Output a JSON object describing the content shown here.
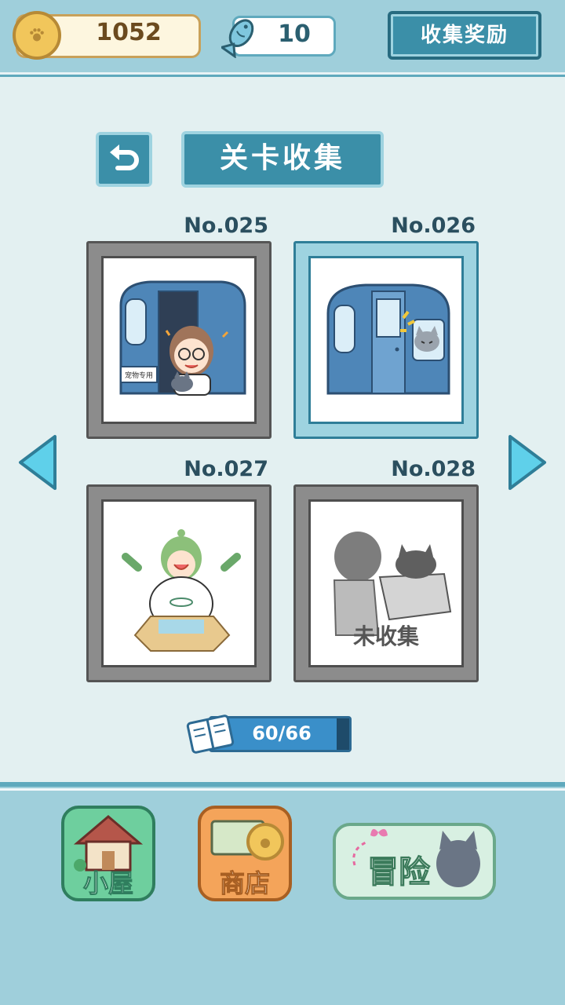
{
  "header": {
    "coins": "1052",
    "fish": "10",
    "reward_button": "收集奖励"
  },
  "page": {
    "title": "关卡收集"
  },
  "cards": [
    {
      "number": "No.025",
      "status": "collected",
      "sign": "宠物专用"
    },
    {
      "number": "No.026",
      "status": "collected",
      "selected": true
    },
    {
      "number": "No.027",
      "status": "collected"
    },
    {
      "number": "No.028",
      "status": "uncollected",
      "overlay": "未收集"
    }
  ],
  "progress": {
    "text": "60/66",
    "collected": 60,
    "total": 66
  },
  "nav": {
    "house": "小屋",
    "shop": "商店",
    "adventure": "冒险"
  },
  "colors": {
    "accent": "#3b8fa8",
    "selected_border": "#2f7e98",
    "progress": "#3a8fc9"
  }
}
